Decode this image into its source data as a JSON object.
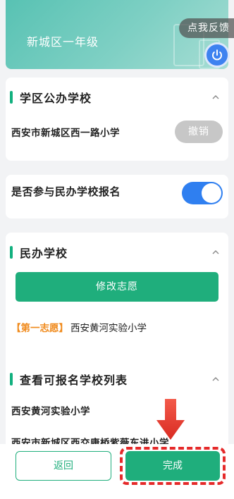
{
  "banner": {
    "title": "新城区一年级"
  },
  "feedback": {
    "label": "点我反馈"
  },
  "public_section": {
    "title": "学区公办学校",
    "school": "西安市新城区西一路小学",
    "cancel_label": "撤销"
  },
  "private_toggle": {
    "label": "是否参与民办学校报名",
    "enabled": true
  },
  "private_section": {
    "title": "民办学校",
    "modify_label": "修改志愿",
    "first_choice_tag": "【第一志愿】",
    "first_choice_school": "西安黄河实验小学"
  },
  "available_section": {
    "title": "查看可报名学校列表",
    "schools": [
      "西安黄河实验小学",
      "西安市新城区西交康桥紫薇东进小学"
    ]
  },
  "footer": {
    "back_label": "返回",
    "done_label": "完成"
  },
  "colors": {
    "primary": "#1fae7c",
    "toggle_on": "#2f7ff0",
    "tag": "#f08a1c",
    "annotation": "#e52a2a"
  }
}
